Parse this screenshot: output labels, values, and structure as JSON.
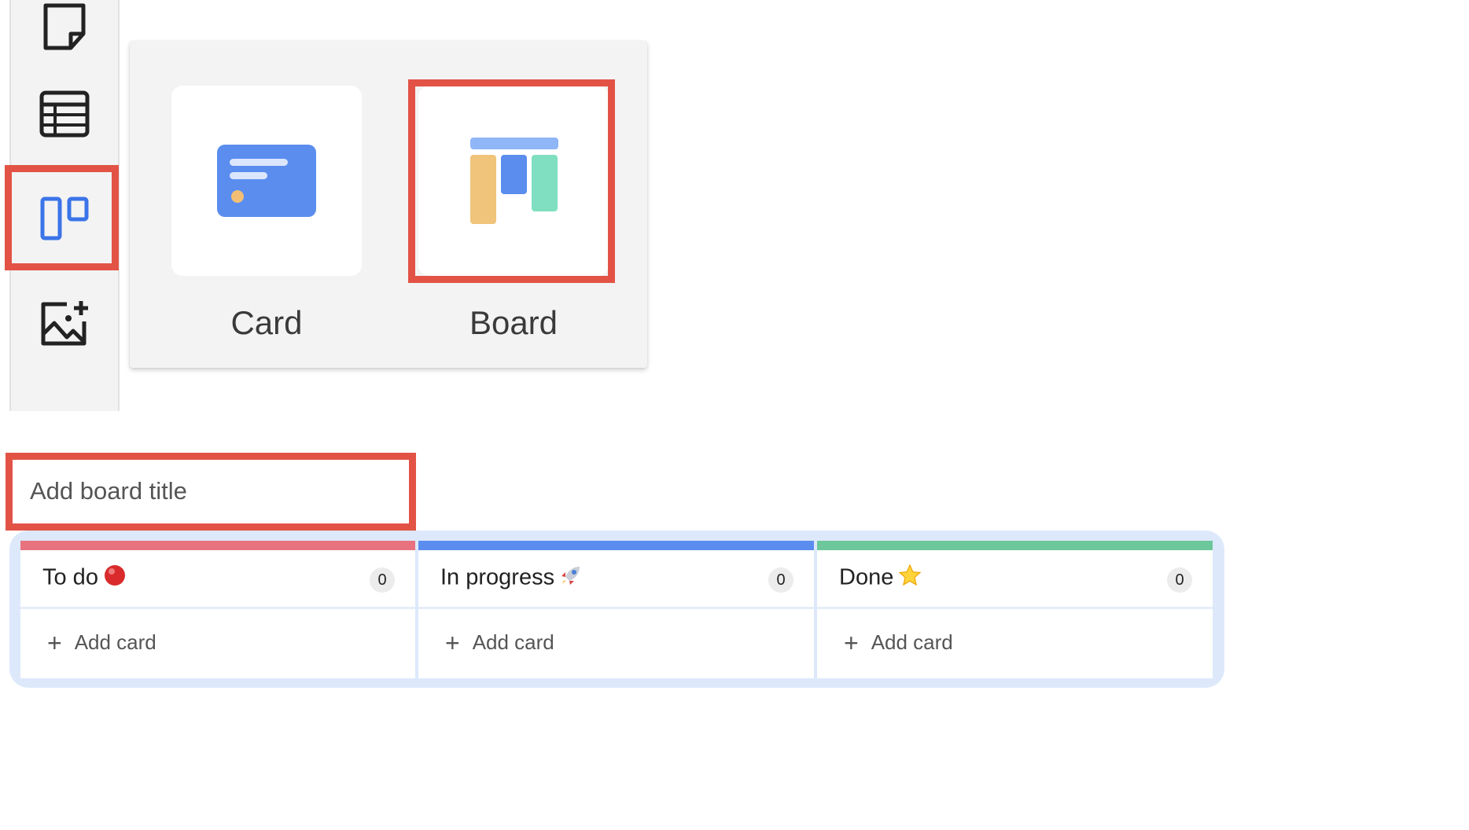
{
  "picker": {
    "options": [
      {
        "label": "Card"
      },
      {
        "label": "Board"
      }
    ]
  },
  "board": {
    "title_placeholder": "Add board title",
    "columns": [
      {
        "name": "To do",
        "count": "0",
        "add_label": "Add card",
        "color": "#e8737e"
      },
      {
        "name": "In progress",
        "count": "0",
        "add_label": "Add card",
        "color": "#5b8def"
      },
      {
        "name": "Done",
        "count": "0",
        "add_label": "Add card",
        "color": "#6cc79a"
      }
    ]
  },
  "colors": {
    "highlight": "#e25346",
    "accent_blue": "#3b74e8",
    "board_bg": "#dde9fb"
  }
}
